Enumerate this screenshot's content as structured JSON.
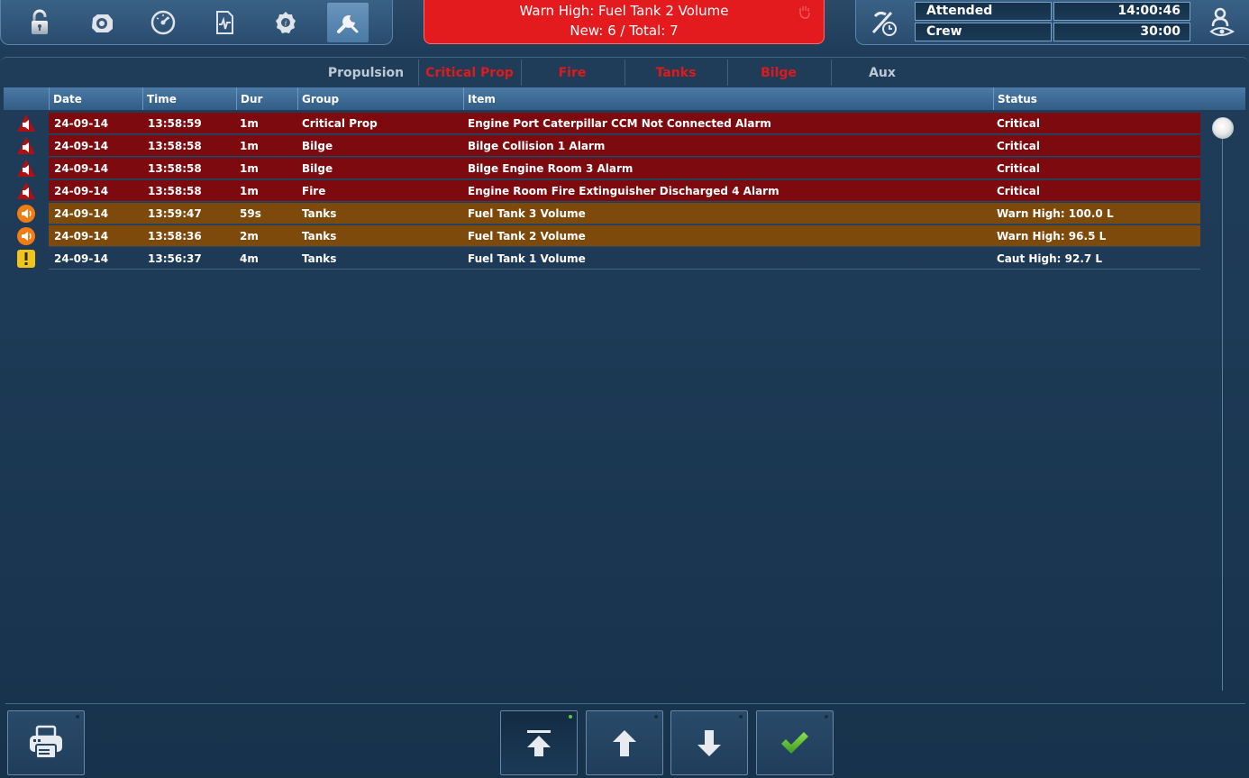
{
  "banner": {
    "line1": "Warn High: Fuel Tank 2 Volume",
    "line2": "New: 6 / Total: 7"
  },
  "status": {
    "mode_label": "Attended",
    "mode_value": "14:00:46",
    "crew_label": "Crew",
    "crew_value": "30:00"
  },
  "tabs": [
    {
      "label": "Propulsion",
      "alarm": false
    },
    {
      "label": "Critical Prop",
      "alarm": true
    },
    {
      "label": "Fire",
      "alarm": true
    },
    {
      "label": "Tanks",
      "alarm": true
    },
    {
      "label": "Bilge",
      "alarm": true
    },
    {
      "label": "Aux",
      "alarm": false
    }
  ],
  "columns": {
    "date": "Date",
    "time": "Time",
    "dur": "Dur",
    "group": "Group",
    "item": "Item",
    "status": "Status"
  },
  "rows": [
    {
      "level": "critical",
      "date": "24-09-14",
      "time": "13:58:59",
      "dur": "1m",
      "group": "Critical Prop",
      "item": "Engine Port Caterpillar CCM Not Connected Alarm",
      "status": "Critical"
    },
    {
      "level": "critical",
      "date": "24-09-14",
      "time": "13:58:58",
      "dur": "1m",
      "group": "Bilge",
      "item": "Bilge Collision 1 Alarm",
      "status": "Critical"
    },
    {
      "level": "critical",
      "date": "24-09-14",
      "time": "13:58:58",
      "dur": "1m",
      "group": "Bilge",
      "item": "Bilge Engine Room 3 Alarm",
      "status": "Critical"
    },
    {
      "level": "critical",
      "date": "24-09-14",
      "time": "13:58:58",
      "dur": "1m",
      "group": "Fire",
      "item": "Engine Room Fire Extinguisher Discharged 4 Alarm",
      "status": "Critical"
    },
    {
      "level": "warn",
      "date": "24-09-14",
      "time": "13:59:47",
      "dur": "59s",
      "group": "Tanks",
      "item": "Fuel Tank 3 Volume",
      "status": "Warn High: 100.0 L"
    },
    {
      "level": "warn",
      "date": "24-09-14",
      "time": "13:58:36",
      "dur": "2m",
      "group": "Tanks",
      "item": "Fuel Tank 2 Volume",
      "status": "Warn High: 96.5 L"
    },
    {
      "level": "caution",
      "date": "24-09-14",
      "time": "13:56:37",
      "dur": "4m",
      "group": "Tanks",
      "item": "Fuel Tank 1 Volume",
      "status": "Caut High: 92.7 L"
    }
  ],
  "colors": {
    "critical_row": "#7c0a0e",
    "warn_row": "#7d4a0c",
    "banner": "#e31b1e",
    "alarm_tab_text": "#e01a1a"
  }
}
